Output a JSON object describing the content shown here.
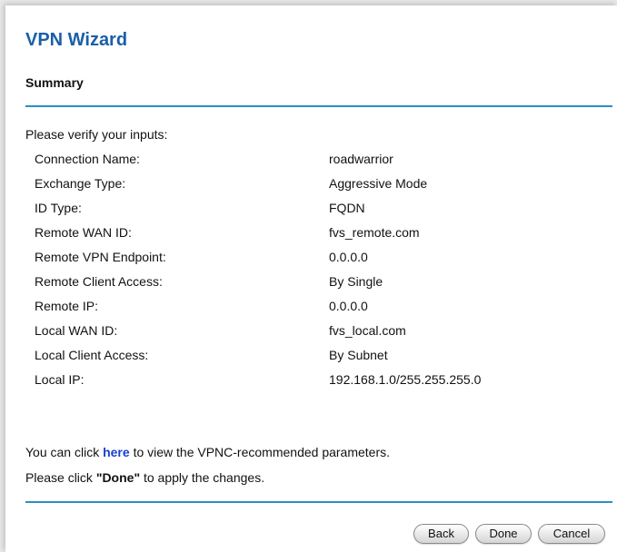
{
  "wizard": {
    "title": "VPN Wizard",
    "section": "Summary",
    "intro": "Please verify your inputs:"
  },
  "summary_rows": [
    {
      "label": "Connection Name:",
      "value": "roadwarrior"
    },
    {
      "label": "Exchange Type:",
      "value": "Aggressive Mode"
    },
    {
      "label": "ID Type:",
      "value": "FQDN"
    },
    {
      "label": "Remote WAN ID:",
      "value": "fvs_remote.com"
    },
    {
      "label": "Remote VPN Endpoint:",
      "value": "0.0.0.0"
    },
    {
      "label": "Remote Client Access:",
      "value": "By Single"
    },
    {
      "label": "Remote IP:",
      "value": "0.0.0.0"
    },
    {
      "label": "Local WAN ID:",
      "value": "fvs_local.com"
    },
    {
      "label": "Local Client Access:",
      "value": "By Subnet"
    },
    {
      "label": "Local IP:",
      "value": "192.168.1.0/255.255.255.0"
    }
  ],
  "notes": {
    "vpnc_prefix": "You can click",
    "vpnc_link": "here",
    "vpnc_suffix": "to view the VPNC-recommended parameters.",
    "done_prefix": "Please click",
    "done_emphasis": "\"Done\"",
    "done_suffix": "to apply the changes."
  },
  "buttons": {
    "back": "Back",
    "done": "Done",
    "cancel": "Cancel"
  },
  "colors": {
    "title": "#1a5fa8",
    "rule": "#2a8fc0",
    "link": "#1a3fd0",
    "background": "#ffffff"
  }
}
